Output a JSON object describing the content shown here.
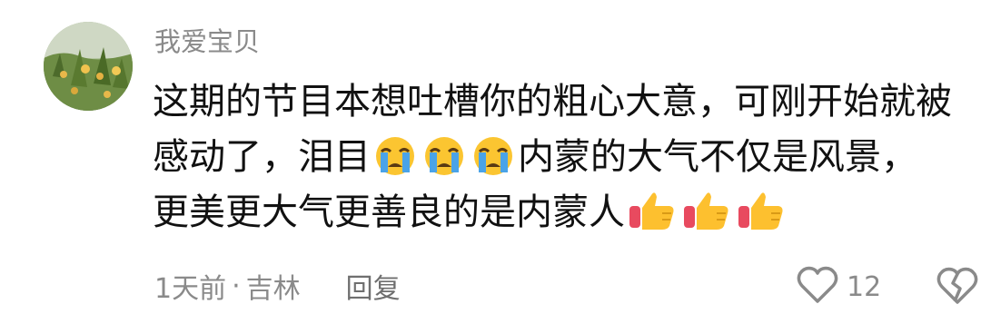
{
  "comment": {
    "username": "我爱宝贝",
    "text_line1": "这期的节目本想吐槽你的粗心大意，可刚开始就被",
    "text_line2_a": "感动了，泪目",
    "text_line2_b": "内蒙的大气不仅是风景，",
    "text_line3": "更美更大气更善良的是内蒙人",
    "emoji_cry": "crying-face-emoji",
    "emoji_thumbs": "thumbs-up-emoji",
    "time": "1天前",
    "separator": "·",
    "location": "吉林",
    "reply_label": "回复",
    "like_count": "12"
  }
}
